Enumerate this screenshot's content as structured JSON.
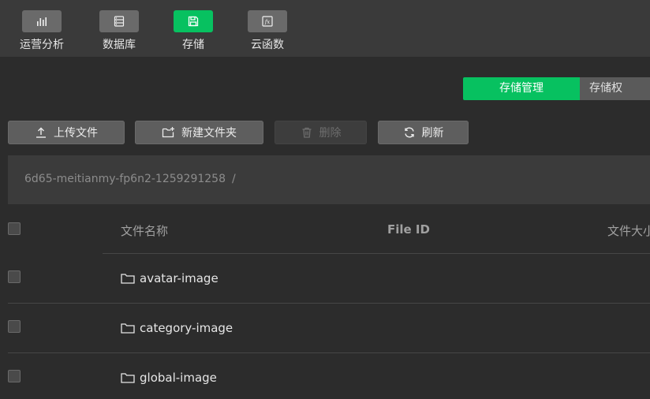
{
  "nav": {
    "items": [
      {
        "label": "运营分析",
        "icon": "bar-chart-icon",
        "active": false
      },
      {
        "label": "数据库",
        "icon": "database-icon",
        "active": false
      },
      {
        "label": "存储",
        "icon": "storage-icon",
        "active": true
      },
      {
        "label": "云函数",
        "icon": "function-icon",
        "active": false
      }
    ]
  },
  "tabs": [
    {
      "label": "存储管理",
      "active": true
    },
    {
      "label": "存储权",
      "active": false
    }
  ],
  "toolbar": {
    "upload_label": "上传文件",
    "new_folder_label": "新建文件夹",
    "delete_label": "删除",
    "refresh_label": "刷新"
  },
  "path": {
    "bucket": "6d65-meitianmy-fp6n2-1259291258",
    "separator": "/"
  },
  "table": {
    "headers": [
      "文件名称",
      "File ID",
      "文件大小"
    ],
    "rows": [
      {
        "name": "avatar-image",
        "type": "folder"
      },
      {
        "name": "category-image",
        "type": "folder"
      },
      {
        "name": "global-image",
        "type": "folder"
      }
    ]
  },
  "colors": {
    "accent": "#07c160",
    "background": "#2c2c2c",
    "topbar": "#3a3a3a"
  }
}
